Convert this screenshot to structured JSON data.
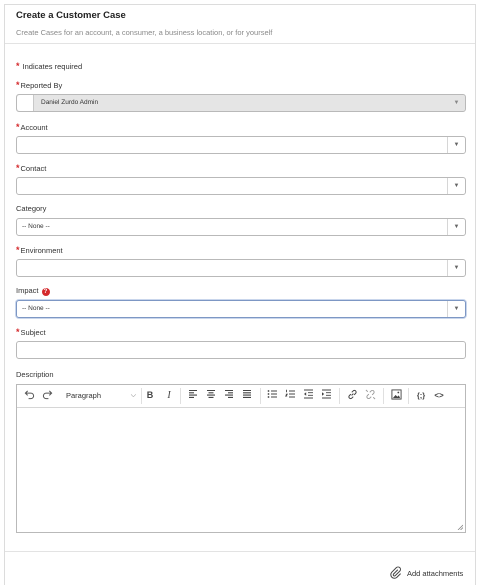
{
  "header": {
    "title": "Create a Customer Case",
    "subtitle": "Create Cases for an account, a consumer, a business location, or for yourself"
  },
  "required_note": "Indicates required",
  "fields": {
    "reported_by": {
      "label": "Reported By",
      "value": "Daniel Zurdo Admin",
      "required": true
    },
    "account": {
      "label": "Account",
      "value": "",
      "required": true
    },
    "contact": {
      "label": "Contact",
      "value": "",
      "required": true
    },
    "category": {
      "label": "Category",
      "value": "-- None --",
      "required": false
    },
    "environment": {
      "label": "Environment",
      "value": "",
      "required": true
    },
    "impact": {
      "label": "Impact",
      "value": "-- None --",
      "required": false
    },
    "subject": {
      "label": "Subject",
      "value": "",
      "required": true
    },
    "description": {
      "label": "Description",
      "value": ""
    }
  },
  "editor": {
    "block_format": "Paragraph",
    "tools": [
      "undo-icon",
      "redo-icon",
      "bold-icon",
      "italic-icon",
      "align-left-icon",
      "align-center-icon",
      "align-right-icon",
      "align-justify-icon",
      "bulleted-list-icon",
      "numbered-list-icon",
      "outdent-icon",
      "indent-icon",
      "link-icon",
      "unlink-icon",
      "image-icon",
      "code-snippet-icon",
      "source-code-icon"
    ]
  },
  "footer": {
    "attach_label": "Add attachments"
  },
  "colors": {
    "required": "#d4292c",
    "focus_border": "#7d97c4",
    "disabled_bg": "#e5e5e5"
  }
}
